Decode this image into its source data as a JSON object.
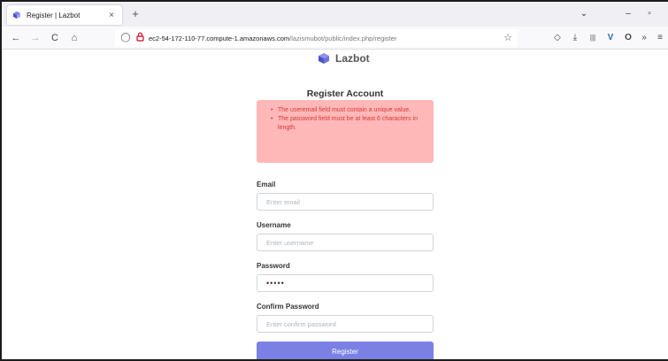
{
  "browser": {
    "tab_title": "Register | Lazbot",
    "tab_close": "×",
    "new_tab": "+",
    "url_host": "ec2-54-172-110-77.compute-1.amazonaws.com",
    "url_path": "/lazismubot/public/index.php/register",
    "icons": {
      "back": "←",
      "forward": "→",
      "reload": "C",
      "home": "⌂",
      "shield": "◯",
      "star": "☆",
      "pocket": "◇",
      "download": "⤓",
      "library": "|||",
      "vimeo": "V",
      "extension": "O",
      "more": "»",
      "menu": "≡",
      "tabs_list": "⌄",
      "minimize": "–",
      "restore": "▫"
    },
    "brand_color": "#2b6cb0"
  },
  "page": {
    "brand_name": "Lazbot",
    "card_title": "Register Account",
    "errors": [
      "The useremail field must contain a unique value.",
      "The password field must be at least 6 characters in length."
    ],
    "form": {
      "email_label": "Email",
      "email_placeholder": "Enter email",
      "email_value": "",
      "username_label": "Username",
      "username_placeholder": "Enter username",
      "username_value": "",
      "password_label": "Password",
      "password_value": "•••••",
      "confirm_label": "Confirm Password",
      "confirm_placeholder": "Enter confirm password",
      "confirm_value": "",
      "submit_label": "Register"
    },
    "colors": {
      "alert_bg": "#ffb8b8",
      "alert_text": "#d93636",
      "button_bg": "#7b80e4"
    }
  }
}
